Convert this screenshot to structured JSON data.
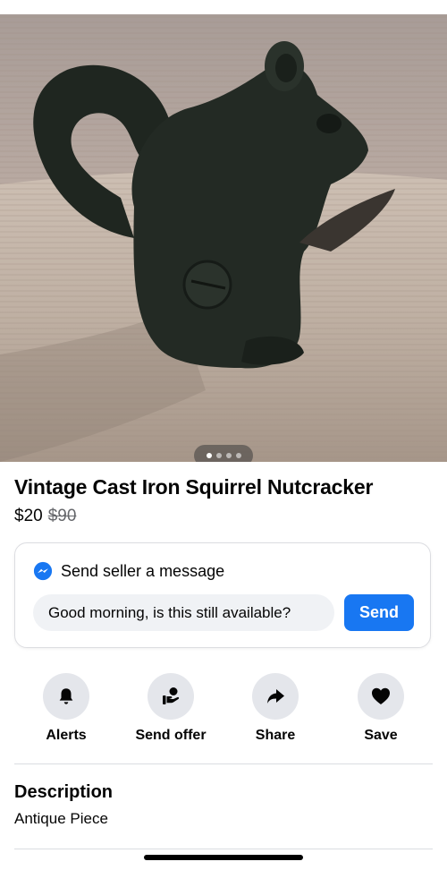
{
  "listing": {
    "title": "Vintage Cast Iron Squirrel Nutcracker",
    "price": "$20",
    "original_price": "$90",
    "photo_count": 4,
    "active_photo_index": 0
  },
  "message_card": {
    "title": "Send seller a message",
    "input_value": "Good morning, is this still available?",
    "send_label": "Send",
    "accent_color": "#1877f2"
  },
  "actions": [
    {
      "label": "Alerts",
      "icon": "bell-icon"
    },
    {
      "label": "Send offer",
      "icon": "offer-hand-icon"
    },
    {
      "label": "Share",
      "icon": "share-arrow-icon"
    },
    {
      "label": "Save",
      "icon": "heart-icon"
    }
  ],
  "description": {
    "heading": "Description",
    "text": "Antique Piece"
  }
}
